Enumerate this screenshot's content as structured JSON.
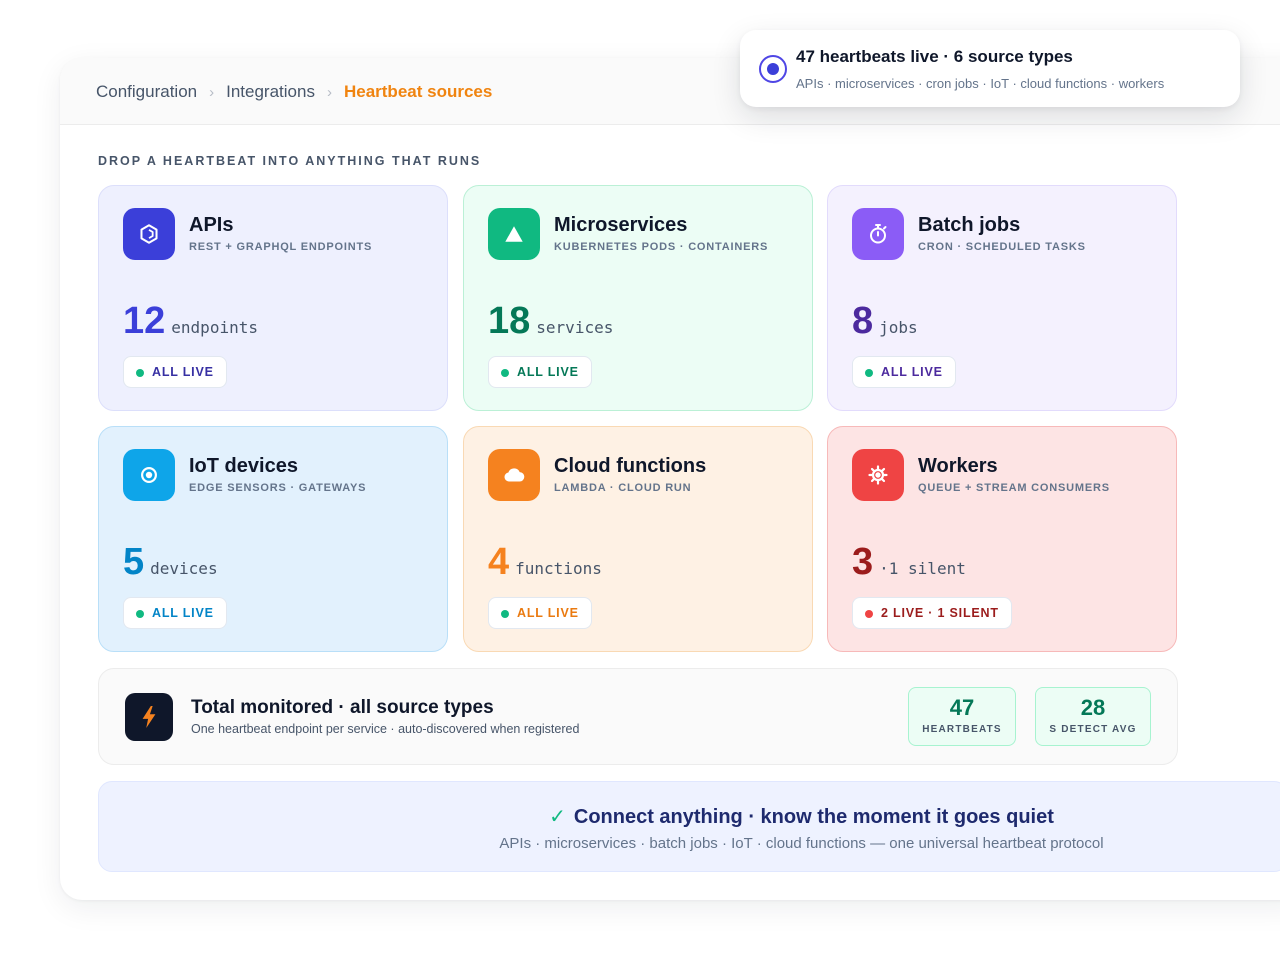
{
  "breadcrumb": {
    "items": [
      "Configuration",
      "Integrations"
    ],
    "current": "Heartbeat sources"
  },
  "toast": {
    "title": "47 heartbeats live · 6 source types",
    "subtitle": "APIs · microservices · cron jobs · IoT · cloud functions · workers"
  },
  "section_label": "DROP A HEARTBEAT INTO ANYTHING THAT RUNS",
  "cards": [
    {
      "title": "APIs",
      "subtitle": "REST + GRAPHQL ENDPOINTS",
      "count": "12",
      "unit": "endpoints",
      "status": "ALL LIVE",
      "icon": "hexagon-icon",
      "accent": "#3b3fd9",
      "bg": "#eef0fe",
      "border": "#dcdffb",
      "count_color": "#3b3fd9",
      "status_color": "#3730a3",
      "dot_color": "#10b981"
    },
    {
      "title": "Microservices",
      "subtitle": "KUBERNETES PODS · CONTAINERS",
      "count": "18",
      "unit": "services",
      "status": "ALL LIVE",
      "icon": "triangle-icon",
      "accent": "#10b981",
      "bg": "#ecfdf5",
      "border": "#bbf0d6",
      "count_color": "#047857",
      "status_color": "#047857",
      "dot_color": "#10b981"
    },
    {
      "title": "Batch jobs",
      "subtitle": "CRON · SCHEDULED TASKS",
      "count": "8",
      "unit": "jobs",
      "status": "ALL LIVE",
      "icon": "stopwatch-icon",
      "accent": "#8b5cf6",
      "bg": "#f4f1fe",
      "border": "#e2dbfc",
      "count_color": "#4c2a9e",
      "status_color": "#4c2a9e",
      "dot_color": "#10b981"
    },
    {
      "title": "IoT devices",
      "subtitle": "EDGE SENSORS · GATEWAYS",
      "count": "5",
      "unit": "devices",
      "status": "ALL LIVE",
      "icon": "sensor-icon",
      "accent": "#0ea5e9",
      "bg": "#e2f1fd",
      "border": "#b9dff8",
      "count_color": "#0284c7",
      "status_color": "#0284c7",
      "dot_color": "#10b981"
    },
    {
      "title": "Cloud functions",
      "subtitle": "LAMBDA · CLOUD RUN",
      "count": "4",
      "unit": "functions",
      "status": "ALL LIVE",
      "icon": "cloud-icon",
      "accent": "#f5821f",
      "bg": "#fef1e4",
      "border": "#f9d9b4",
      "count_color": "#f5821f",
      "status_color": "#ea7a10",
      "dot_color": "#10b981"
    },
    {
      "title": "Workers",
      "subtitle": "QUEUE + STREAM CONSUMERS",
      "count": "3",
      "unit": "·1 silent",
      "status": "2 LIVE · 1 SILENT",
      "icon": "gear-icon",
      "accent": "#ef4444",
      "bg": "#fde4e4",
      "border": "#f7b9b9",
      "count_color": "#9b1c1c",
      "status_color": "#9b1c1c",
      "dot_color": "#ef4444"
    }
  ],
  "total": {
    "title": "Total monitored · all source types",
    "subtitle": "One heartbeat endpoint per service · auto-discovered when registered",
    "stats": [
      {
        "value": "47",
        "label": "HEARTBEATS"
      },
      {
        "value": "28",
        "label": "S DETECT AVG"
      }
    ]
  },
  "banner": {
    "title": "Connect anything · know the moment it goes quiet",
    "check": "✓",
    "subtitle": "APIs · microservices · batch jobs · IoT · cloud functions — one universal heartbeat protocol"
  }
}
